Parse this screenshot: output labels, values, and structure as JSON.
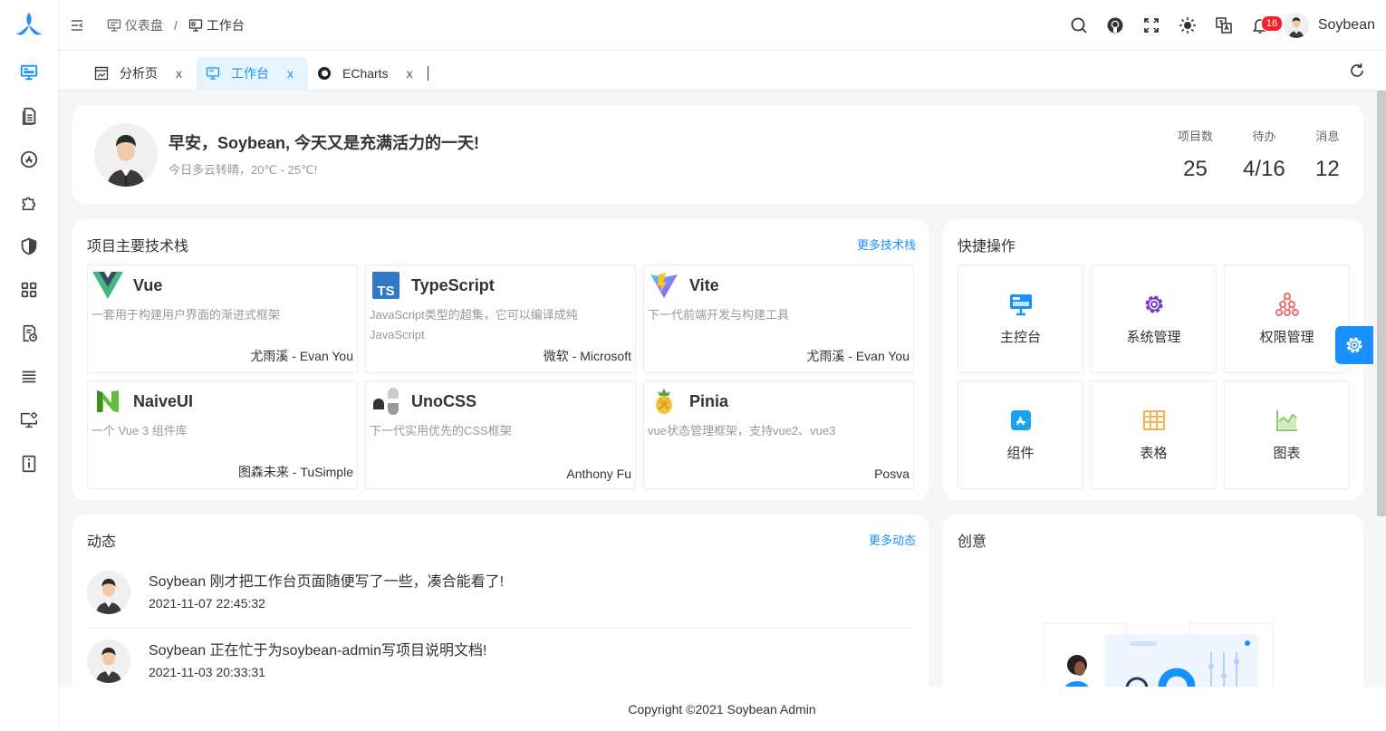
{
  "app": {
    "logo": "soybean-logo"
  },
  "sidebar": {
    "items": [
      {
        "name": "sidebar-item-dashboard",
        "icon": "monitor-icon",
        "active": true
      },
      {
        "name": "sidebar-item-document",
        "icon": "document-icon"
      },
      {
        "name": "sidebar-item-component",
        "icon": "app-store-icon"
      },
      {
        "name": "sidebar-item-plugin",
        "icon": "puzzle-icon"
      },
      {
        "name": "sidebar-item-auth",
        "icon": "shield-icon"
      },
      {
        "name": "sidebar-item-menu",
        "icon": "grid-icon"
      },
      {
        "name": "sidebar-item-exception",
        "icon": "report-icon"
      },
      {
        "name": "sidebar-item-list",
        "icon": "list-icon"
      },
      {
        "name": "sidebar-item-management",
        "icon": "desktop-gear-icon"
      },
      {
        "name": "sidebar-item-about",
        "icon": "info-icon"
      }
    ]
  },
  "header": {
    "breadcrumb": [
      {
        "label": "仪表盘"
      },
      {
        "label": "工作台"
      }
    ],
    "breadcrumb_sep": "/",
    "notification_count": "16",
    "username": "Soybean"
  },
  "tabs": [
    {
      "label": "分析页",
      "close": "x"
    },
    {
      "label": "工作台",
      "close": "x"
    },
    {
      "label": "ECharts",
      "close": "x"
    }
  ],
  "welcome": {
    "greeting": "早安，Soybean, 今天又是充满活力的一天!",
    "weather": "今日多云转晴，20℃ - 25℃!",
    "stats": [
      {
        "label": "项目数",
        "value": "25"
      },
      {
        "label": "待办",
        "value": "4/16"
      },
      {
        "label": "消息",
        "value": "12"
      }
    ]
  },
  "tech": {
    "title": "项目主要技术栈",
    "more": "更多技术栈",
    "items": [
      {
        "name": "Vue",
        "desc": "一套用于构建用户界面的渐进式框架",
        "author": "尤雨溪 - Evan You"
      },
      {
        "name": "TypeScript",
        "desc": "JavaScript类型的超集，它可以编译成纯JavaScript",
        "author": "微软 - Microsoft"
      },
      {
        "name": "Vite",
        "desc": "下一代前端开发与构建工具",
        "author": "尤雨溪 - Evan You"
      },
      {
        "name": "NaiveUI",
        "desc": "一个 Vue 3 组件库",
        "author": "图森未来 - TuSimple"
      },
      {
        "name": "UnoCSS",
        "desc": "下一代实用优先的CSS框架",
        "author": "Anthony Fu"
      },
      {
        "name": "Pinia",
        "desc": "vue状态管理框架，支持vue2、vue3",
        "author": "Posva"
      }
    ]
  },
  "quick": {
    "title": "快捷操作",
    "items": [
      {
        "label": "主控台",
        "color": "#1890ff"
      },
      {
        "label": "系统管理",
        "color": "#7238d1"
      },
      {
        "label": "权限管理",
        "color": "#f56c6c"
      },
      {
        "label": "组件",
        "color": "#19a2f1"
      },
      {
        "label": "表格",
        "color": "#fab251"
      },
      {
        "label": "图表",
        "color": "#8aca6b"
      }
    ]
  },
  "activity": {
    "title": "动态",
    "more": "更多动态",
    "items": [
      {
        "text": "Soybean 刚才把工作台页面随便写了一些，凑合能看了!",
        "time": "2021-11-07 22:45:32"
      },
      {
        "text": "Soybean 正在忙于为soybean-admin写项目说明文档!",
        "time": "2021-11-03 20:33:31"
      }
    ]
  },
  "creative": {
    "title": "创意"
  },
  "footer": {
    "copyright": "Copyright ©2021 Soybean Admin"
  },
  "colors": {
    "primary": "#1890ff",
    "badge": "#f5222d"
  }
}
